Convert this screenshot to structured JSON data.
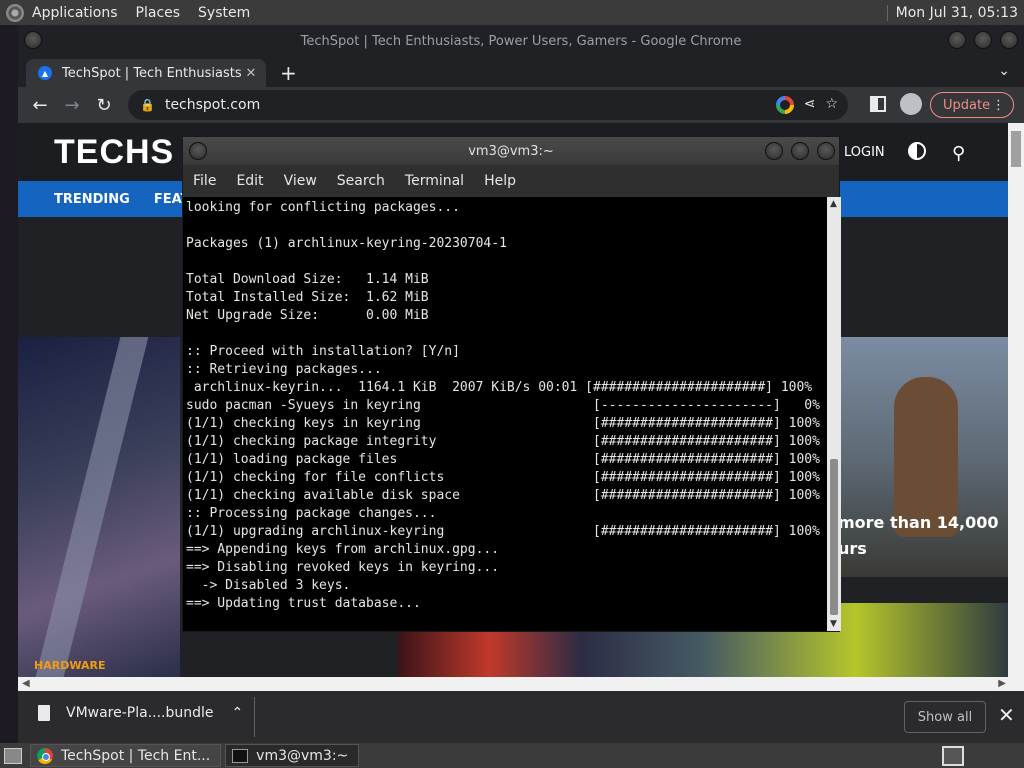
{
  "top_panel": {
    "menus": [
      "Applications",
      "Places",
      "System"
    ],
    "clock": "Mon Jul 31, 05:13"
  },
  "chrome": {
    "window_title": "TechSpot | Tech Enthusiasts, Power Users, Gamers - Google Chrome",
    "tab_title": "TechSpot | Tech Enthusiasts, P",
    "url": "techspot.com",
    "update_label": "Update"
  },
  "site": {
    "logo": "TECHS",
    "login": "LOGIN",
    "nav": [
      "TRENDING",
      "FEAT"
    ],
    "hero_text_line1": "more than 14,000",
    "hero_text_line2": "urs",
    "section_label": "HARDWARE"
  },
  "downloads": {
    "filename": "VMware-Pla....bundle",
    "show_all": "Show all"
  },
  "terminal": {
    "title": "vm3@vm3:~",
    "menu": [
      "File",
      "Edit",
      "View",
      "Search",
      "Terminal",
      "Help"
    ],
    "lines": [
      "looking for conflicting packages...",
      "",
      "Packages (1) archlinux-keyring-20230704-1",
      "",
      "Total Download Size:   1.14 MiB",
      "Total Installed Size:  1.62 MiB",
      "Net Upgrade Size:      0.00 MiB",
      "",
      ":: Proceed with installation? [Y/n]",
      ":: Retrieving packages...",
      " archlinux-keyrin...  1164.1 KiB  2007 KiB/s 00:01 [######################] 100%",
      "sudo pacman -Syueys in keyring                      [----------------------]   0%",
      "(1/1) checking keys in keyring                      [######################] 100%",
      "(1/1) checking package integrity                    [######################] 100%",
      "(1/1) loading package files                         [######################] 100%",
      "(1/1) checking for file conflicts                   [######################] 100%",
      "(1/1) checking available disk space                 [######################] 100%",
      ":: Processing package changes...",
      "(1/1) upgrading archlinux-keyring                   [######################] 100%",
      "==> Appending keys from archlinux.gpg...",
      "==> Disabling revoked keys in keyring...",
      "  -> Disabled 3 keys.",
      "==> Updating trust database..."
    ]
  },
  "taskbar": {
    "tasks": [
      "TechSpot | Tech Ent...",
      "vm3@vm3:~"
    ]
  }
}
